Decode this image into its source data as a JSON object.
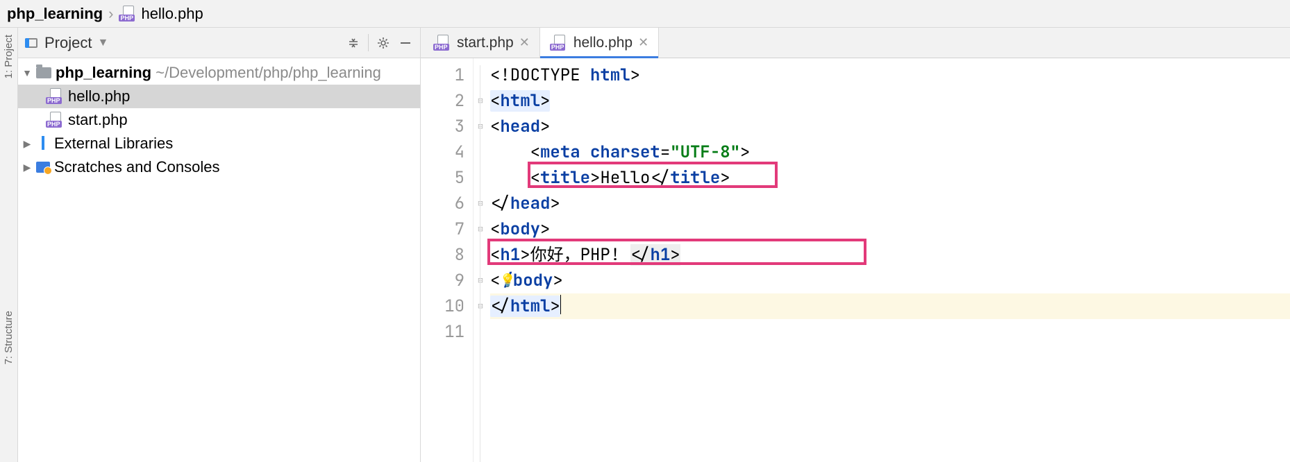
{
  "breadcrumb": {
    "root": "php_learning",
    "file": "hello.php"
  },
  "sidestrip": {
    "project_label": "1: Project",
    "structure_label": "7: Structure"
  },
  "project": {
    "title": "Project",
    "root": {
      "name": "php_learning",
      "path": "~/Development/php/php_learning"
    },
    "files": [
      {
        "name": "hello.php",
        "selected": true
      },
      {
        "name": "start.php",
        "selected": false
      }
    ],
    "external": "External Libraries",
    "scratches": "Scratches and Consoles"
  },
  "tabs": [
    {
      "name": "start.php",
      "active": false
    },
    {
      "name": "hello.php",
      "active": true
    }
  ],
  "code": {
    "lines": [
      "1",
      "2",
      "3",
      "4",
      "5",
      "6",
      "7",
      "8",
      "9",
      "10",
      "11"
    ],
    "l1": {
      "a": "<!DOCTYPE ",
      "b": "html",
      "c": ">"
    },
    "l2": {
      "a": "<",
      "b": "html",
      "c": ">"
    },
    "l3": {
      "a": "<",
      "b": "head",
      "c": ">"
    },
    "l4": {
      "ind": "    ",
      "a": "<",
      "b": "meta ",
      "c": "charset",
      "d": "=",
      "e": "\"UTF-8\"",
      "f": ">"
    },
    "l5": {
      "ind": "    ",
      "a": "<",
      "b": "title",
      "c": ">",
      "txt": "Hello",
      "d": "</",
      "e": "title",
      "f": ">"
    },
    "l6": {
      "a": "</",
      "b": "head",
      "c": ">"
    },
    "l7": {
      "a": "<",
      "b": "body",
      "c": ">"
    },
    "l8": {
      "a": "<",
      "b": "h1",
      "c": ">",
      "txt": "你好，PHP! ",
      "d": "</",
      "e": "h1",
      "f": ">"
    },
    "l9": {
      "a": "<",
      "b": "/body",
      "c": ">"
    },
    "l10": {
      "a": "</",
      "b": "html",
      "c": ">"
    }
  }
}
